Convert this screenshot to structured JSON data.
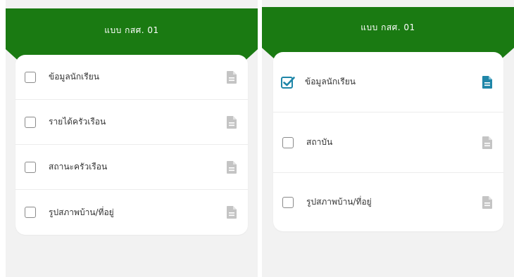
{
  "colors": {
    "header_green": "#1a7a12",
    "check_blue": "#1f86a8",
    "doc_grey": "#c4c4c4"
  },
  "left_panel": {
    "header_title": "แบบ กสศ. 01",
    "items": [
      {
        "label": "ข้อมูลนักเรียน",
        "checked": false,
        "icon": "document-icon"
      },
      {
        "label": "รายได้ครัวเรือน",
        "checked": false,
        "icon": "document-icon"
      },
      {
        "label": "สถานะครัวเรือน",
        "checked": false,
        "icon": "document-icon"
      },
      {
        "label": "รูปสภาพบ้าน/ที่อยู่",
        "checked": false,
        "icon": "document-icon"
      }
    ]
  },
  "right_panel": {
    "header_title": "แบบ กสศ. 01",
    "items": [
      {
        "label": "ข้อมูลนักเรียน",
        "checked": true,
        "icon": "document-icon"
      },
      {
        "label": "สถาบัน",
        "checked": false,
        "icon": "document-icon"
      },
      {
        "label": "รูปสภาพบ้าน/ที่อยู่",
        "checked": false,
        "icon": "document-icon"
      }
    ]
  }
}
